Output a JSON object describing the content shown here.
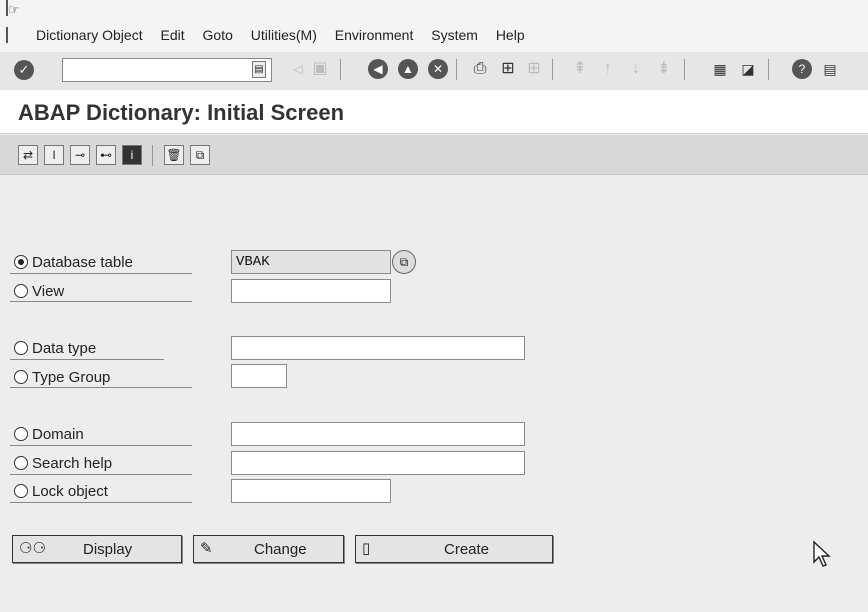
{
  "menu": {
    "items": [
      "Dictionary Object",
      "Edit",
      "Goto",
      "Utilities(M)",
      "Environment",
      "System",
      "Help"
    ]
  },
  "system_toolbar": {
    "command_field_value": ""
  },
  "title": "ABAP Dictionary: Initial Screen",
  "form": {
    "options": [
      {
        "label": "Database table",
        "selected": true,
        "value": "VBAK"
      },
      {
        "label": "View",
        "selected": false,
        "value": ""
      },
      {
        "label": "Data type",
        "selected": false,
        "value": ""
      },
      {
        "label": "Type Group",
        "selected": false,
        "value": ""
      },
      {
        "label": "Domain",
        "selected": false,
        "value": ""
      },
      {
        "label": "Search help",
        "selected": false,
        "value": ""
      },
      {
        "label": "Lock object",
        "selected": false,
        "value": ""
      }
    ]
  },
  "buttons": {
    "display": "Display",
    "change": "Change",
    "create": "Create"
  }
}
